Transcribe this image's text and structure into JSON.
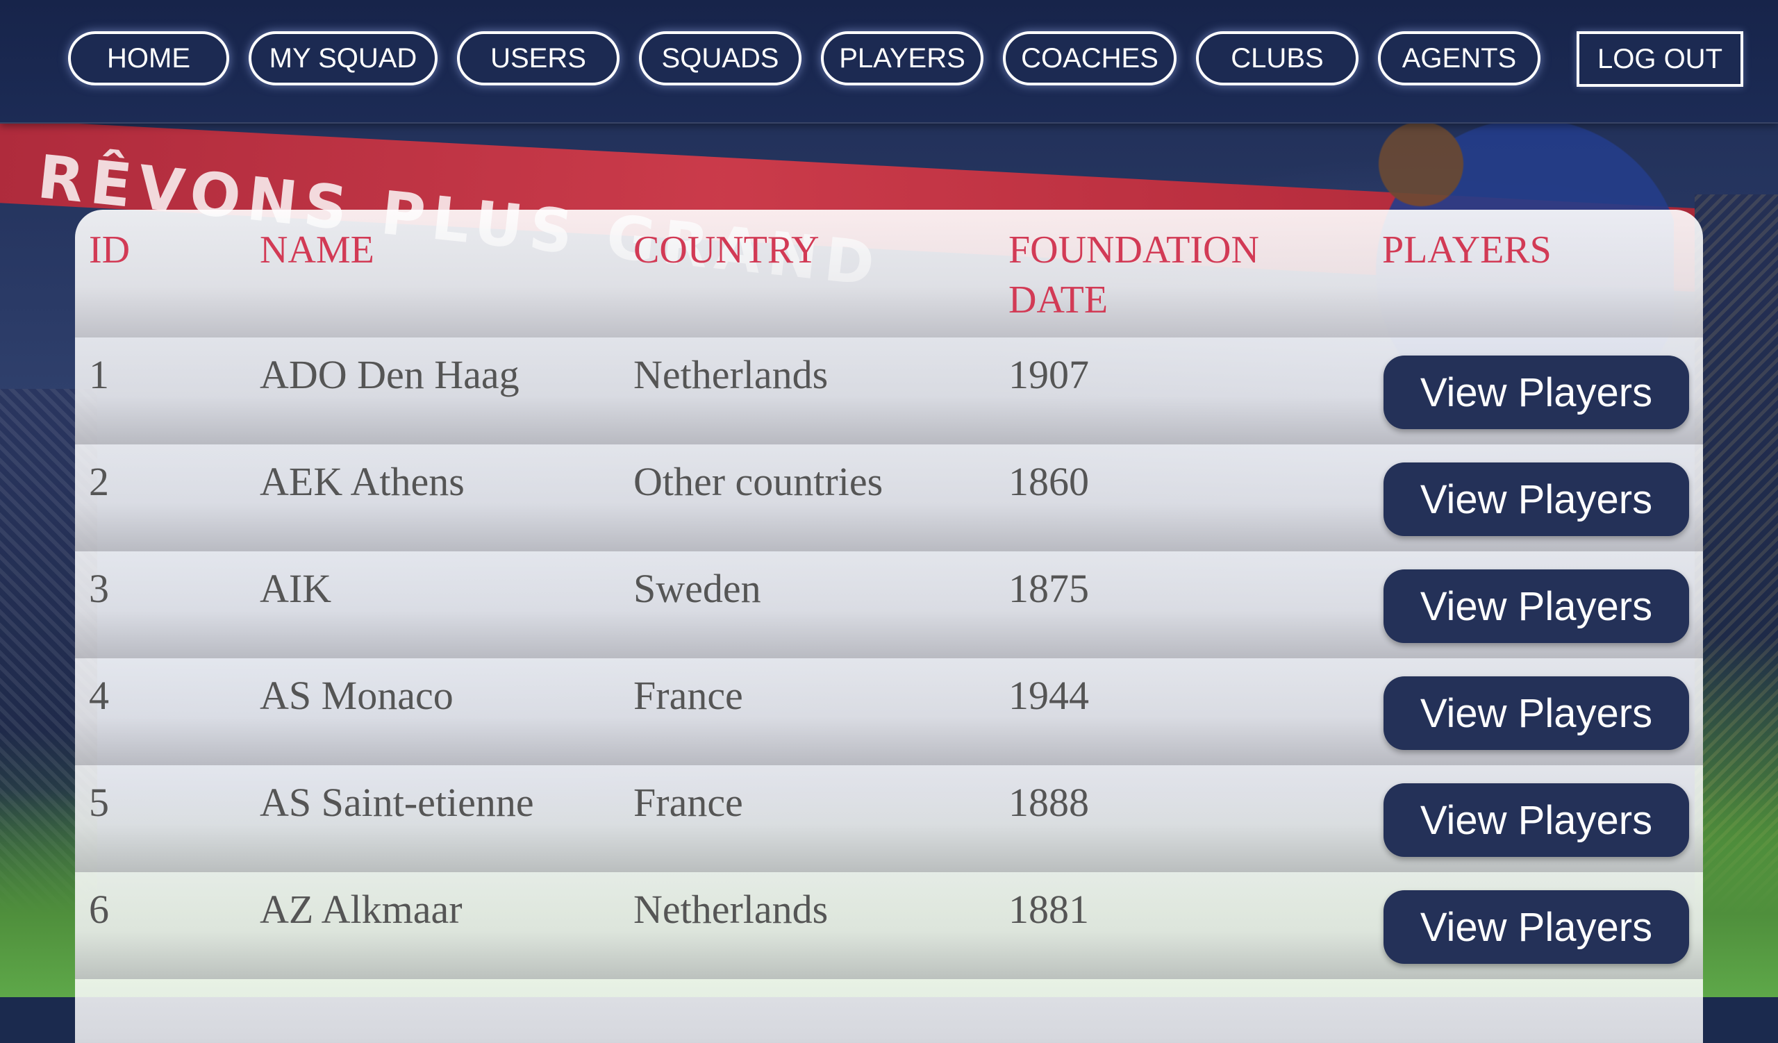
{
  "nav": {
    "items": [
      {
        "label": "HOME"
      },
      {
        "label": "MY SQUAD"
      },
      {
        "label": "USERS"
      },
      {
        "label": "SQUADS"
      },
      {
        "label": "PLAYERS"
      },
      {
        "label": "COACHES"
      },
      {
        "label": "CLUBS"
      },
      {
        "label": "AGENTS"
      }
    ],
    "logout_label": "LOG OUT"
  },
  "background": {
    "banner_text": "RÊVONS PLUS GRAND"
  },
  "table": {
    "columns": [
      "ID",
      "NAME",
      "COUNTRY",
      "FOUNDATION DATE",
      "PLAYERS"
    ],
    "rows": [
      {
        "id": "1",
        "name": "ADO Den Haag",
        "country": "Netherlands",
        "foundation_date": "1907",
        "action_label": "View Players"
      },
      {
        "id": "2",
        "name": "AEK Athens",
        "country": "Other countries",
        "foundation_date": "1860",
        "action_label": "View Players"
      },
      {
        "id": "3",
        "name": "AIK",
        "country": "Sweden",
        "foundation_date": "1875",
        "action_label": "View Players"
      },
      {
        "id": "4",
        "name": "AS Monaco",
        "country": "France",
        "foundation_date": "1944",
        "action_label": "View Players"
      },
      {
        "id": "5",
        "name": "AS Saint-etienne",
        "country": "France",
        "foundation_date": "1888",
        "action_label": "View Players"
      },
      {
        "id": "6",
        "name": "AZ Alkmaar",
        "country": "Netherlands",
        "foundation_date": "1881",
        "action_label": "View Players"
      }
    ]
  },
  "colors": {
    "nav_bg": "#1c2a52",
    "header_text": "#d23a55",
    "cell_text": "#555555",
    "action_button": "#243158"
  }
}
